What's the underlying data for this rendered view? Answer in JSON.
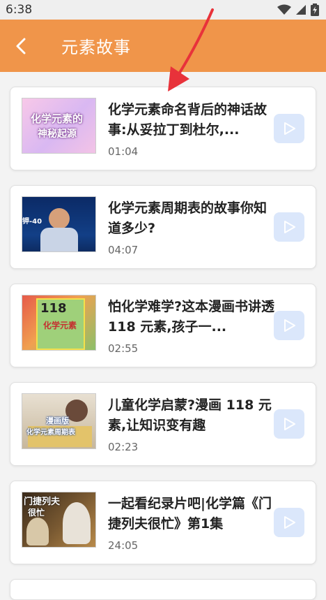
{
  "status_bar": {
    "time": "6:38"
  },
  "app_bar": {
    "title": "元素故事"
  },
  "videos": [
    {
      "title": "化学元素命名背后的神话故事:从妥拉丁到杜尔,...",
      "duration": "01:04",
      "thumb_text": [
        "化学元素的",
        "神秘起源"
      ]
    },
    {
      "title": "化学元素周期表的故事你知道多少?",
      "duration": "04:07",
      "thumb_text": [
        "钾-40"
      ]
    },
    {
      "title": "怕化学难学?这本漫画书讲透 118 元素,孩子一...",
      "duration": "02:55",
      "thumb_text": [
        "118",
        "化学元素"
      ]
    },
    {
      "title": "儿童化学启蒙?漫画 118 元素,让知识变有趣",
      "duration": "02:23",
      "thumb_text": [
        "漫画版",
        "化学元素周期表"
      ]
    },
    {
      "title": "一起看纪录片吧|化学篇《门捷列夫很忙》第1集",
      "duration": "24:05",
      "thumb_text": [
        "门捷列夫",
        "很忙"
      ]
    }
  ]
}
